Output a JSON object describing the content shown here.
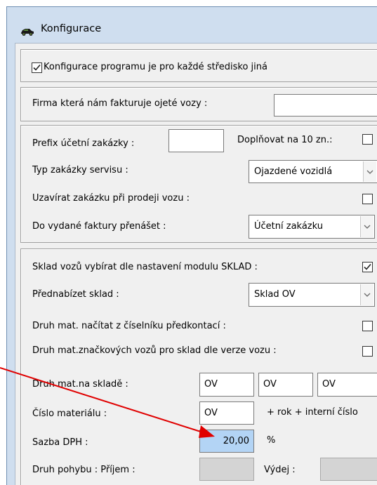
{
  "window": {
    "title": "Konfigurace",
    "icon": "car-icon"
  },
  "section1": {
    "branch_specific_label": "Konfigurace programu je pro každé středisko jiná",
    "branch_specific_checked": true
  },
  "section2": {
    "invoicing_company_label": "Firma která nám fakturuje ojeté vozy :",
    "invoicing_company_value": ""
  },
  "section3": {
    "prefix_label": "Prefix účetní zakázky :",
    "prefix_value": "",
    "pad_label": "Doplňovat na 10 zn.:",
    "pad_checked": false,
    "order_type_label": "Typ zakázky servisu :",
    "order_type_value": "Ojazdené vozidlá",
    "close_order_label": "Uzavírat zakázku při prodeji vozu :",
    "close_order_checked": false,
    "invoice_transfer_label": "Do vydané faktury přenášet :",
    "invoice_transfer_value": "Účetní zakázku"
  },
  "section4": {
    "warehouse_select_label": "Sklad vozů vybírat dle nastavení modulu SKLAD :",
    "warehouse_select_checked": true,
    "preselect_label": "Přednabízet sklad :",
    "preselect_value": "Sklad OV",
    "mat_type_load_label": "Druh mat. načítat z číselníku předkontací :",
    "mat_type_load_checked": false,
    "brand_mat_label": "Druh mat.značkových vozů pro sklad dle verze vozu :",
    "brand_mat_checked": false,
    "stock_mat_label": "Druh mat.na skladě :",
    "stock_mat_values": [
      "OV",
      "OV",
      "OV"
    ],
    "mat_number_label": "Číslo materiálu :",
    "mat_number_value": "OV",
    "mat_number_suffix": "+ rok + interní číslo",
    "vat_label": "Sazba DPH :",
    "vat_value": "20,00",
    "vat_unit": "%",
    "movement_label": "Druh pohybu : Příjem :",
    "movement_in_value": "",
    "movement_out_label": "Výdej :",
    "movement_out_value": ""
  },
  "annotation": {
    "arrow_color": "#e00000"
  }
}
